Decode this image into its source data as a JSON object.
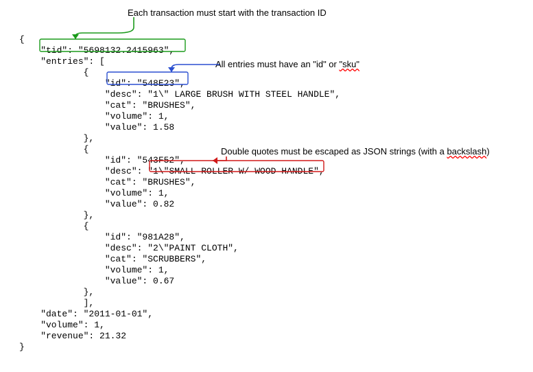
{
  "annotations": {
    "tid_note": "Each transaction must start with the transaction ID",
    "id_note_prefix": "All entries must have an \"id\" or ",
    "id_note_sku": "\"sku\"",
    "quote_note_prefix": "Double quotes must be escaped as JSON strings (with a ",
    "quote_note_backslash": "backslash",
    "quote_note_suffix": ")"
  },
  "code": {
    "open_brace": "{",
    "tid_line": "    \"tid\": \"5698132.2415963\",",
    "entries_open": "    \"entries\": [",
    "obj_open": "            {",
    "e0_id": "                \"id\": \"548E23\",",
    "e0_desc": "                \"desc\": \"1\\\" LARGE BRUSH WITH STEEL HANDLE\",",
    "e0_cat": "                \"cat\": \"BRUSHES\",",
    "e0_volume": "                \"volume\": 1,",
    "e0_value": "                \"value\": 1.58",
    "obj_close": "            },",
    "e1_id": "                \"id\": \"543F52\",",
    "e1_desc_prefix": "                \"desc\": ",
    "e1_desc_value": "\"1\\\"SMALL ROLLER W/ WOOD HANDLE\"",
    "e1_desc_suffix": ",",
    "e1_cat": "                \"cat\": \"BRUSHES\",",
    "e1_volume": "                \"volume\": 1,",
    "e1_value": "                \"value\": 0.82",
    "e2_id": "                \"id\": \"981A28\",",
    "e2_desc": "                \"desc\": \"2\\\"PAINT CLOTH\",",
    "e2_cat": "                \"cat\": \"SCRUBBERS\",",
    "e2_volume": "                \"volume\": 1,",
    "e2_value": "                \"value\": 0.67",
    "entries_close": "            ],",
    "date_line": "    \"date\": \"2011-01-01\",",
    "volume_line": "    \"volume\": 1,",
    "revenue_line": "    \"revenue\": 21.32",
    "close_brace": "}"
  },
  "colors": {
    "green": "#1a9a1a",
    "blue": "#2a4fd0",
    "red": "#d01818"
  }
}
